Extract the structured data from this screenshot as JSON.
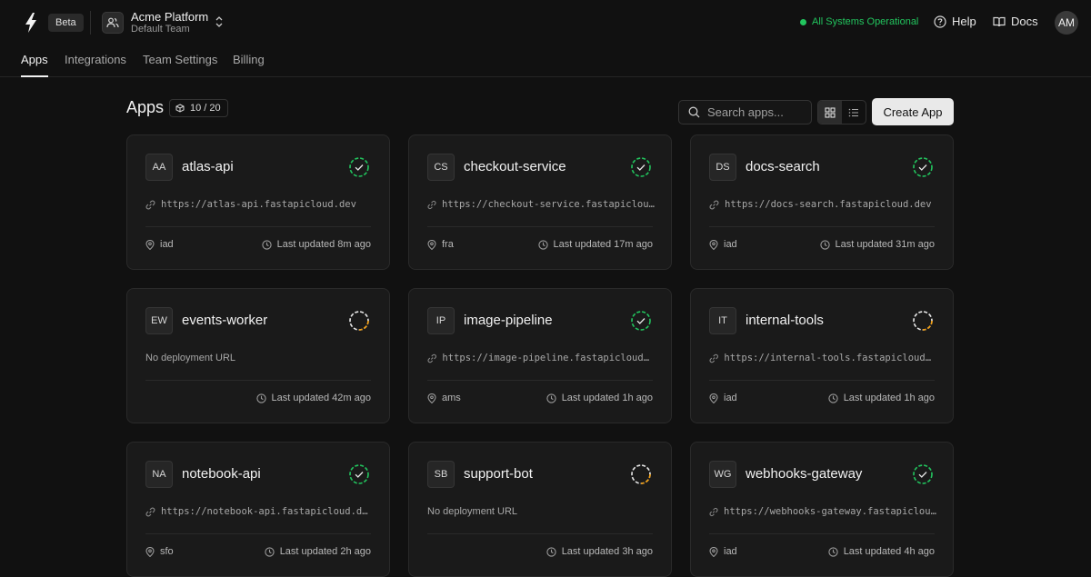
{
  "header": {
    "badge": "Beta",
    "team_name": "Acme Platform",
    "team_sub": "Default Team",
    "status": "All Systems Operational",
    "help": "Help",
    "docs": "Docs",
    "avatar": "AM",
    "colors": {
      "status": "#22c55e",
      "background": "#111111",
      "card": "#1a1a1a",
      "pending": "#f59e0b"
    }
  },
  "tabs": [
    "Apps",
    "Integrations",
    "Team Settings",
    "Billing"
  ],
  "active_tab": "Apps",
  "page": {
    "title": "Apps",
    "count": "10 / 20",
    "search_placeholder": "Search apps...",
    "create_label": "Create App",
    "view_mode": "grid"
  },
  "apps": [
    {
      "initials": "AA",
      "name": "atlas-api",
      "url": "https://atlas-api.fastapicloud.dev",
      "region": "iad",
      "updated": "Last updated 8m ago",
      "status": "ok",
      "status_icon": "check-circle-icon"
    },
    {
      "initials": "CS",
      "name": "checkout-service",
      "url": "https://checkout-service.fastapicloud.dev",
      "region": "fra",
      "updated": "Last updated 17m ago",
      "status": "ok",
      "status_icon": "check-circle-icon"
    },
    {
      "initials": "DS",
      "name": "docs-search",
      "url": "https://docs-search.fastapicloud.dev",
      "region": "iad",
      "updated": "Last updated 31m ago",
      "status": "ok",
      "status_icon": "check-circle-icon"
    },
    {
      "initials": "EW",
      "name": "events-worker",
      "url": "",
      "no_url": "No deployment URL",
      "region": "",
      "updated": "Last updated 42m ago",
      "status": "pending",
      "status_icon": "spinner-icon"
    },
    {
      "initials": "IP",
      "name": "image-pipeline",
      "url": "https://image-pipeline.fastapicloud.dev",
      "region": "ams",
      "updated": "Last updated 1h ago",
      "status": "ok",
      "status_icon": "check-circle-icon"
    },
    {
      "initials": "IT",
      "name": "internal-tools",
      "url": "https://internal-tools.fastapicloud.dev",
      "region": "iad",
      "updated": "Last updated 1h ago",
      "status": "pending",
      "status_icon": "spinner-icon"
    },
    {
      "initials": "NA",
      "name": "notebook-api",
      "url": "https://notebook-api.fastapicloud.dev",
      "region": "sfo",
      "updated": "Last updated 2h ago",
      "status": "ok",
      "status_icon": "check-circle-icon"
    },
    {
      "initials": "SB",
      "name": "support-bot",
      "url": "",
      "no_url": "No deployment URL",
      "region": "",
      "updated": "Last updated 3h ago",
      "status": "pending",
      "status_icon": "spinner-icon"
    },
    {
      "initials": "WG",
      "name": "webhooks-gateway",
      "url": "https://webhooks-gateway.fastapicloud.dev",
      "region": "iad",
      "updated": "Last updated 4h ago",
      "status": "ok",
      "status_icon": "check-circle-icon"
    }
  ]
}
